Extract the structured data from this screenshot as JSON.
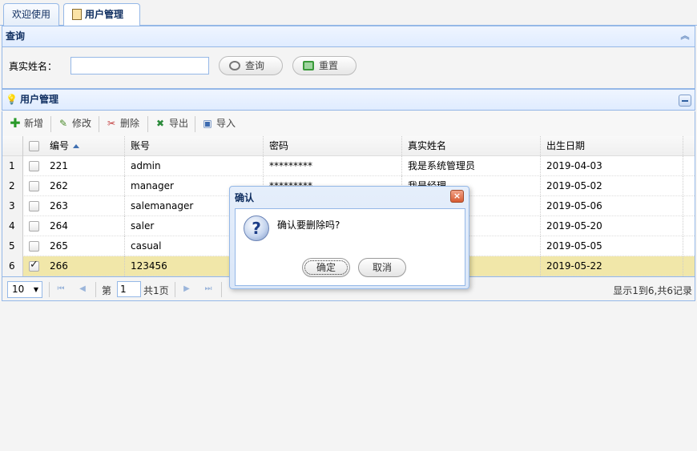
{
  "tabs": [
    {
      "label": "欢迎使用"
    },
    {
      "label": "用户管理",
      "close": "×"
    }
  ],
  "search_panel": {
    "title": "查询",
    "name_label": "真实姓名：",
    "name_value": "",
    "search_button": "查询",
    "reset_button": "重置"
  },
  "grid_panel": {
    "title": "用户管理",
    "toolbar": {
      "add": "新增",
      "edit": "修改",
      "delete": "删除",
      "export": "导出",
      "import": "导入"
    },
    "columns": [
      "编号",
      "账号",
      "密码",
      "真实姓名",
      "出生日期"
    ],
    "rows": [
      {
        "rn": "1",
        "id": "221",
        "account": "admin",
        "password": "*********",
        "name": "我是系统管理员",
        "birth": "2019-04-03",
        "checked": false
      },
      {
        "rn": "2",
        "id": "262",
        "account": "manager",
        "password": "*********",
        "name": "我是经理",
        "birth": "2019-05-02",
        "checked": false
      },
      {
        "rn": "3",
        "id": "263",
        "account": "salemanager",
        "password": "",
        "name": "",
        "birth": "2019-05-06",
        "checked": false
      },
      {
        "rn": "4",
        "id": "264",
        "account": "saler",
        "password": "",
        "name": "",
        "birth": "2019-05-20",
        "checked": false
      },
      {
        "rn": "5",
        "id": "265",
        "account": "casual",
        "password": "",
        "name": "",
        "birth": "2019-05-05",
        "checked": false
      },
      {
        "rn": "6",
        "id": "266",
        "account": "123456",
        "password": "",
        "name": "",
        "birth": "2019-05-22",
        "checked": true
      }
    ]
  },
  "pager": {
    "page_size": "10",
    "page_prefix": "第",
    "page_value": "1",
    "page_suffix": "共1页",
    "info": "显示1到6,共6记录"
  },
  "dialog": {
    "title": "确认",
    "close": "×",
    "icon": "?",
    "message": "确认要删除吗?",
    "ok": "确定",
    "cancel": "取消"
  },
  "colors": {
    "border": "#95b8e7",
    "selected_row": "#f1e7a9",
    "header_text": "#0e2d5f"
  }
}
